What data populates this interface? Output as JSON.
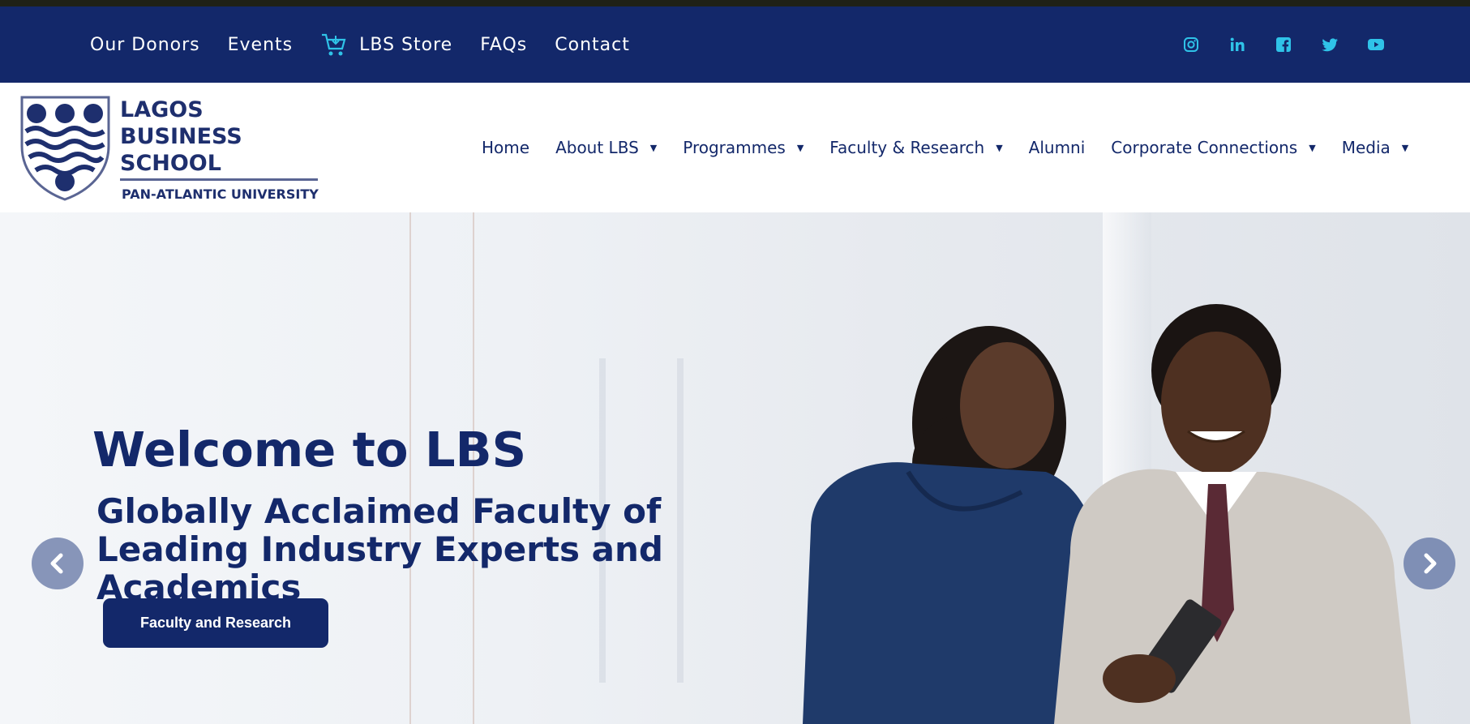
{
  "topbar": {
    "links": [
      {
        "label": "Our Donors"
      },
      {
        "label": "Events"
      },
      {
        "label": "LBS Store"
      },
      {
        "label": "FAQs"
      },
      {
        "label": "Contact"
      }
    ],
    "social_icons": [
      "instagram-icon",
      "linkedin-icon",
      "facebook-icon",
      "twitter-icon",
      "youtube-icon"
    ]
  },
  "logo": {
    "line1": "LAGOS",
    "line2": "BUSINESS",
    "line3": "SCHOOL",
    "subtitle": "PAN-ATLANTIC UNIVERSITY"
  },
  "nav": {
    "items": [
      {
        "label": "Home"
      },
      {
        "label": "About LBS"
      },
      {
        "label": "Programmes"
      },
      {
        "label": "Faculty & Research"
      },
      {
        "label": "Alumni"
      },
      {
        "label": "Corporate Connections"
      },
      {
        "label": "Media"
      }
    ],
    "caret": "▼"
  },
  "hero": {
    "title": "Welcome to LBS",
    "subtitle_line1": "Globally Acclaimed Faculty of",
    "subtitle_line2": "Leading Industry Experts and Academics",
    "cta_label": "Faculty and Research"
  },
  "colors": {
    "brand_navy": "#13286a",
    "accent_cyan": "#2fc3e8",
    "arrow_bg": "#8795b9"
  }
}
